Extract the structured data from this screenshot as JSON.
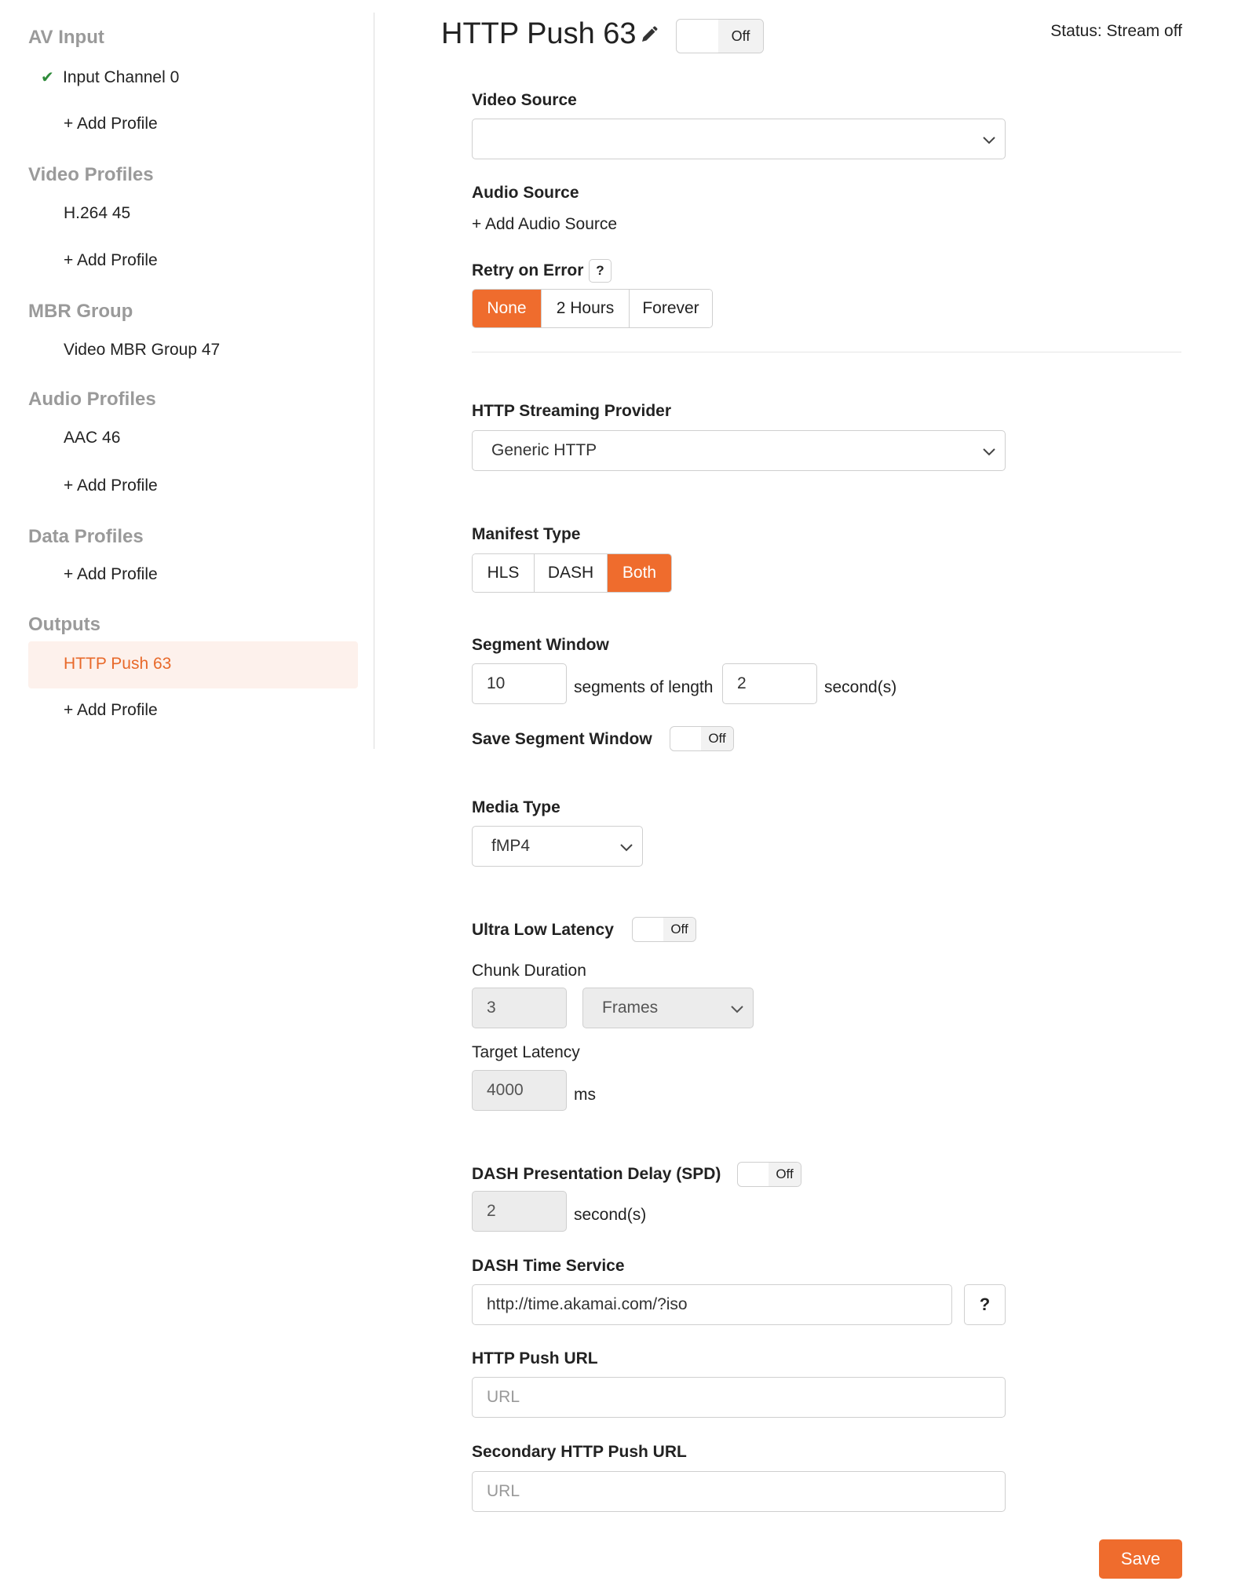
{
  "sidebar": {
    "av_input": {
      "title": "AV Input",
      "items": [
        "Input Channel 0"
      ],
      "add": "+ Add Profile"
    },
    "video_profiles": {
      "title": "Video Profiles",
      "items": [
        "H.264 45"
      ],
      "add": "+ Add Profile"
    },
    "mbr_group": {
      "title": "MBR Group",
      "items": [
        "Video MBR Group 47"
      ]
    },
    "audio_profiles": {
      "title": "Audio Profiles",
      "items": [
        "AAC 46"
      ],
      "add": "+ Add Profile"
    },
    "data_profiles": {
      "title": "Data Profiles",
      "add": "+ Add Profile"
    },
    "outputs": {
      "title": "Outputs",
      "items": [
        "HTTP Push 63"
      ],
      "add": "+ Add Profile"
    }
  },
  "header": {
    "title": "HTTP Push 63",
    "toggle_label": "Off",
    "status": "Status: Stream off"
  },
  "form": {
    "video_source": {
      "label": "Video Source",
      "value": ""
    },
    "audio_source": {
      "label": "Audio Source",
      "add": "+ Add Audio Source"
    },
    "retry": {
      "label": "Retry on Error",
      "help": "?",
      "options": [
        "None",
        "2 Hours",
        "Forever"
      ],
      "selected": "None"
    },
    "provider": {
      "label": "HTTP Streaming Provider",
      "value": "Generic HTTP"
    },
    "manifest": {
      "label": "Manifest Type",
      "options": [
        "HLS",
        "DASH",
        "Both"
      ],
      "selected": "Both"
    },
    "segment_window": {
      "label": "Segment Window",
      "count": "10",
      "middle": "segments of length",
      "length": "2",
      "unit": "second(s)"
    },
    "save_segment_window": {
      "label": "Save Segment Window",
      "toggle": "Off"
    },
    "media_type": {
      "label": "Media Type",
      "value": "fMP4"
    },
    "ultra_low_latency": {
      "label": "Ultra Low Latency",
      "toggle": "Off"
    },
    "chunk_duration": {
      "label": "Chunk Duration",
      "value": "3",
      "unit": "Frames"
    },
    "target_latency": {
      "label": "Target Latency",
      "value": "4000",
      "unit": "ms"
    },
    "dash_spd": {
      "label": "DASH Presentation Delay (SPD)",
      "toggle": "Off",
      "value": "2",
      "unit": "second(s)"
    },
    "dash_time_service": {
      "label": "DASH Time Service",
      "value": "http://time.akamai.com/?iso",
      "help": "?"
    },
    "push_url": {
      "label": "HTTP Push URL",
      "placeholder": "URL"
    },
    "secondary_push_url": {
      "label": "Secondary HTTP Push URL",
      "placeholder": "URL"
    },
    "save_label": "Save"
  },
  "colors": {
    "accent": "#ef6c2d",
    "check": "#2e8b3a",
    "section_title": "#9a9a9a"
  }
}
